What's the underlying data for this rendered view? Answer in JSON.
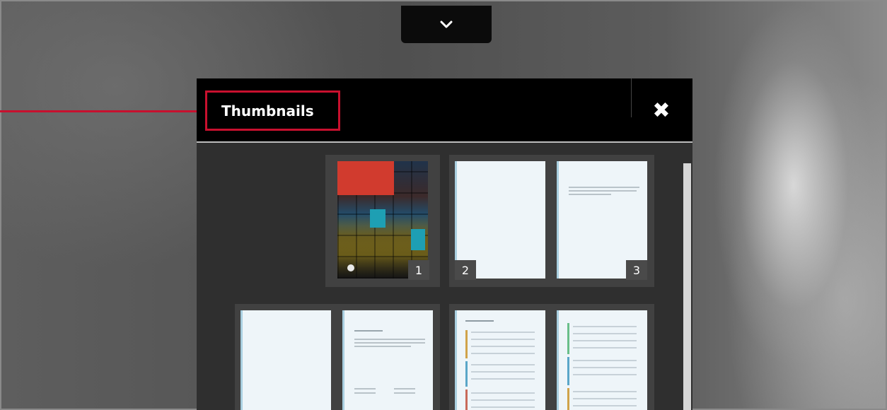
{
  "toolbar": {
    "toggle_icon": "chevron-down-icon"
  },
  "panel": {
    "title": "Thumbnails",
    "close_label": "✖",
    "close_icon": "close-icon"
  },
  "thumbnails": {
    "pages": [
      {
        "number": "1",
        "kind": "cover"
      },
      {
        "number": "2",
        "kind": "blank"
      },
      {
        "number": "3",
        "kind": "text"
      },
      {
        "number": "",
        "kind": "blank"
      },
      {
        "number": "",
        "kind": "text"
      },
      {
        "number": "",
        "kind": "table-of-contents"
      },
      {
        "number": "",
        "kind": "table-of-contents"
      }
    ]
  },
  "colors": {
    "highlight": "#c8102e",
    "panel_bg": "#2f2f2f",
    "header_bg": "#000000",
    "page_bg": "#eef5f9",
    "page_edge": "#a9cfe0"
  }
}
